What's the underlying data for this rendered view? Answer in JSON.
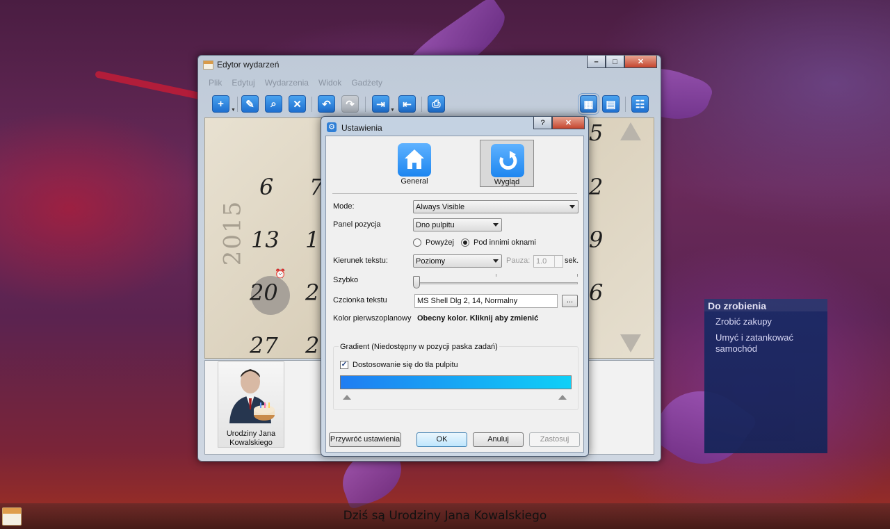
{
  "window": {
    "title": "Edytor wydarzeń",
    "menu": [
      "Plik",
      "Edytuj",
      "Wydarzenia",
      "Widok",
      "Gadżety"
    ],
    "toolbar": [
      {
        "icon": "add-icon",
        "glyph": "+"
      },
      {
        "icon": "edit-icon",
        "glyph": "✎"
      },
      {
        "icon": "search-icon",
        "glyph": "⌕"
      },
      {
        "icon": "delete-icon",
        "glyph": "✕"
      },
      {
        "icon": "undo-icon",
        "glyph": "↶"
      },
      {
        "icon": "redo-icon",
        "glyph": "↷"
      },
      {
        "icon": "export-icon",
        "glyph": "⇥"
      },
      {
        "icon": "import-icon",
        "glyph": "⇤"
      },
      {
        "icon": "print-icon",
        "glyph": "⎙"
      },
      {
        "icon": "month-view-icon",
        "glyph": "▦"
      },
      {
        "icon": "week-view-icon",
        "glyph": "▤"
      },
      {
        "icon": "tree-view-icon",
        "glyph": "☷"
      }
    ]
  },
  "calendar": {
    "year": "2015",
    "days": [
      "6",
      "7",
      "13",
      "1",
      "20",
      "2",
      "27",
      "2",
      "2",
      "9",
      "6",
      "5"
    ]
  },
  "event": {
    "label_line1": "Urodziny Jana",
    "label_line2": "Kowalskiego"
  },
  "dialog": {
    "title": "Ustawienia",
    "help": "?",
    "close": "✕",
    "tabs": [
      {
        "label": "General",
        "icon": "home-icon"
      },
      {
        "label": "Wygląd",
        "icon": "refresh-icon"
      }
    ],
    "mode_label": "Mode:",
    "mode_value": "Always Visible",
    "panel_label": "Panel pozycja",
    "panel_value": "Dno pulpitu",
    "radio_above": "Powyżej",
    "radio_below": "Pod innimi oknami",
    "direction_label": "Kierunek tekstu:",
    "direction_value": "Poziomy",
    "pause_label": "Pauza:",
    "pause_value": "1.0",
    "pause_unit": "sek.",
    "speed_label": "Szybko",
    "font_label": "Czcionka tekstu",
    "font_value": "MS Shell Dlg 2, 14, Normalny",
    "font_button": "...",
    "color_label": "Kolor pierwszoplanowy",
    "color_value": "Obecny kolor. Kliknij aby zmienić",
    "gradient_group": "Gradient (Niedostępny w pozycji paska zadań)",
    "gradient_check": "Dostosowanie się do tła pulpitu",
    "gradient_colors": [
      "#1f7df2",
      "#0fd0f7"
    ],
    "btn_reset": "Przywróć ustawienia",
    "btn_ok": "OK",
    "btn_cancel": "Anuluj",
    "btn_apply": "Zastosuj"
  },
  "todo": {
    "title": "Do zrobienia",
    "items": [
      "Zrobić zakupy",
      "Umyć i zatankować",
      "samochód"
    ]
  },
  "taskbar": {
    "ticker": "Dziś są Urodziny Jana Kowalskiego"
  }
}
